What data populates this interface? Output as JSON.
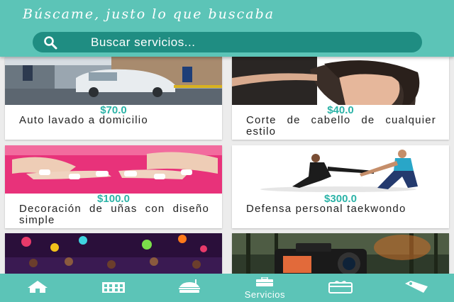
{
  "header": {
    "title": "Búscame, justo lo que buscaba",
    "search": {
      "icon": "search-icon",
      "placeholder": "Buscar servicios..."
    }
  },
  "services": [
    {
      "price": "$70.0",
      "name": "Auto lavado a domicilio",
      "image": "car-wash-photo"
    },
    {
      "price": "$40.0",
      "name": "Corte de cabello de cualquier estilo",
      "image": "haircut-photo"
    },
    {
      "price": "$100.0",
      "name": "Decoración de uñas con diseño simple",
      "image": "nails-photo"
    },
    {
      "price": "$300.0",
      "name": "Defensa personal taekwondo",
      "image": "taekwondo-photo"
    },
    {
      "price": "",
      "name": "",
      "image": "party-photo"
    },
    {
      "price": "",
      "name": "",
      "image": "camera-photo"
    }
  ],
  "bottom_nav": {
    "items": [
      {
        "icon": "home-icon",
        "label": ""
      },
      {
        "icon": "building-icon",
        "label": ""
      },
      {
        "icon": "food-icon",
        "label": ""
      },
      {
        "icon": "briefcase-icon",
        "label": "Servicios",
        "active": true
      },
      {
        "icon": "gift-icon",
        "label": ""
      },
      {
        "icon": "tag-icon",
        "label": ""
      }
    ]
  },
  "colors": {
    "primary": "#5cc4b7",
    "search_bg": "#1f8d82",
    "price": "#2bb3a7"
  }
}
